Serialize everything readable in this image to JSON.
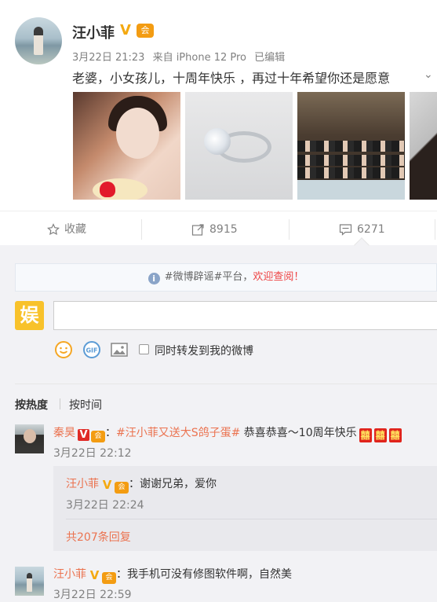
{
  "post": {
    "username": "汪小菲",
    "verified_badge": "V",
    "member_badge": "会",
    "date": "3月22日 21:23",
    "source": "来自 iPhone 12 Pro",
    "edited": "已编辑",
    "text": "老婆，小女孩儿，十周年快乐 ，再过十年希望你还是愿意",
    "images": [
      "couple-birthday-photo",
      "diamond-ring-photo",
      "group-dinner-photo",
      "partial-photo"
    ]
  },
  "actions": {
    "favorite_label": "收藏",
    "repost_count": "8915",
    "comment_count": "6271"
  },
  "notice": {
    "prefix": "#微博辟谣#平台，",
    "highlight": "欢迎查阅！"
  },
  "composer": {
    "logo": "娱",
    "repost_label": "同时转发到我的微博",
    "tools": [
      "smile-icon",
      "gif-icon",
      "image-icon"
    ]
  },
  "sort": {
    "by_hot": "按热度",
    "by_time": "按时间"
  },
  "comments": [
    {
      "name": "秦昊",
      "tag": "#汪小菲又送大S鸽子蛋#",
      "text": " 恭喜恭喜～10周年快乐",
      "emoji": [
        "囍",
        "囍",
        "囍"
      ],
      "time": "3月22日 22:12",
      "reply": {
        "name": "汪小菲",
        "text": "谢谢兄弟，爱你",
        "time": "3月22日 22:24"
      },
      "more_replies": "共207条回复"
    },
    {
      "name": "汪小菲",
      "text": "我手机可没有修图软件啊，自然美",
      "time": "3月22日 22:59"
    }
  ],
  "colors": {
    "link": "#eb7350",
    "verified_gold": "#f4a911",
    "verified_red": "#e02a26",
    "background": "#f2f2f5"
  }
}
